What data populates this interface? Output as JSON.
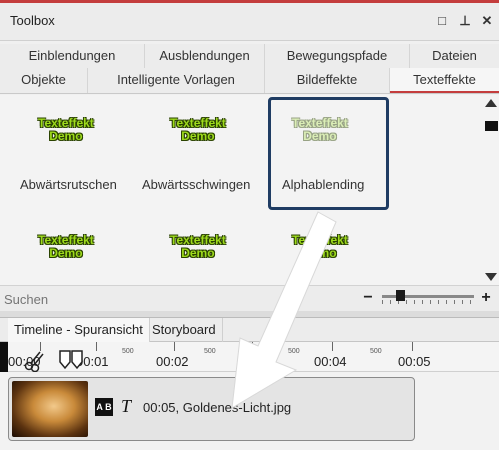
{
  "window": {
    "title": "Toolbox",
    "buttons": {
      "maximize": "□",
      "pin": "⊥",
      "close": "✕"
    }
  },
  "tabs_row1": [
    "Einblendungen",
    "Ausblendungen",
    "Bewegungspfade",
    "Dateien"
  ],
  "tabs_row2": [
    "Objekte",
    "Intelligente Vorlagen",
    "Bildeffekte",
    "Texteffekte"
  ],
  "active_tab": "Texteffekte",
  "effects": {
    "thumb_line1": "Texteffekt",
    "thumb_line2": "Demo",
    "row1_labels": [
      "Abwärtsrutschen",
      "Abwärtsschwingen",
      "Alphablending"
    ],
    "selected": "Alphablending"
  },
  "search": {
    "placeholder": "Suchen",
    "value": ""
  },
  "zoom": {
    "minus": "−",
    "plus": "+",
    "level_fraction": 0.2
  },
  "timeline": {
    "tabs": [
      "Timeline - Spuransicht",
      "Storyboard"
    ],
    "active_tab": "Timeline - Spuransicht",
    "ruler": {
      "labels": [
        "00:00",
        "00:01",
        "00:02",
        "00:04",
        "00:05"
      ],
      "small": [
        "500",
        "500",
        "500",
        "500"
      ]
    },
    "clip": {
      "label": "00:05, Goldenes-Licht.jpg",
      "icon1": "A B",
      "icon2": "T"
    }
  },
  "colors": {
    "accent": "#c43d3d",
    "selection": "#1f3c63",
    "thumb_text": "#9edb1c"
  }
}
